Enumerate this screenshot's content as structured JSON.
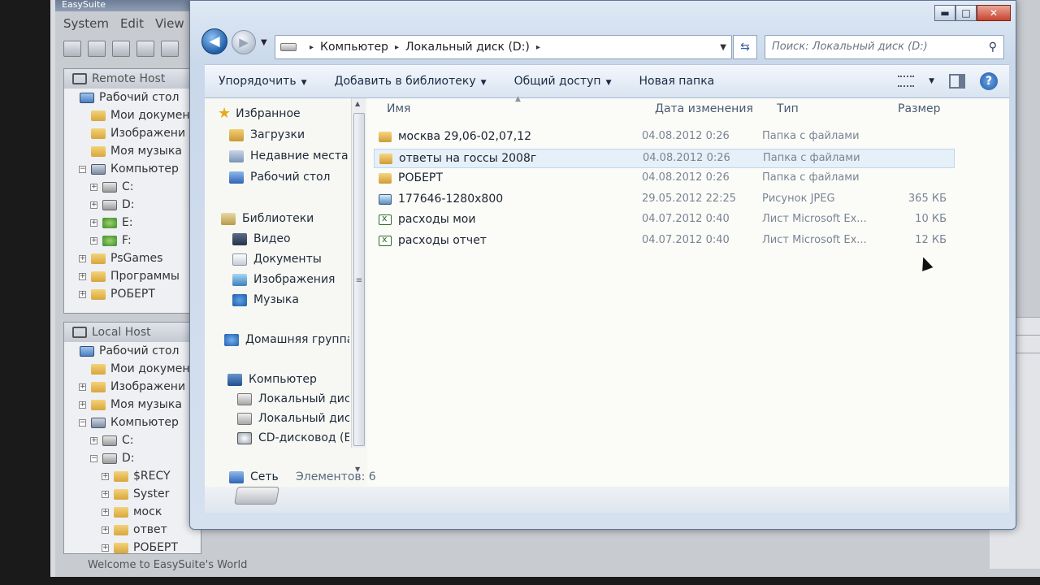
{
  "background_app": {
    "title": "EasySuite",
    "menu": [
      "System",
      "Edit",
      "View"
    ],
    "remote_panel": {
      "title": "Remote Host",
      "items": [
        {
          "label": "Рабочий стол",
          "icon": "desktop-icon",
          "indent": 0,
          "exp": ""
        },
        {
          "label": "Мои докумен",
          "icon": "folder-icon",
          "indent": 1,
          "exp": ""
        },
        {
          "label": "Изображени",
          "icon": "folder-icon",
          "indent": 1,
          "exp": ""
        },
        {
          "label": "Моя музыка",
          "icon": "folder-icon",
          "indent": 1,
          "exp": ""
        },
        {
          "label": "Компьютер",
          "icon": "computer-icon",
          "indent": 1,
          "exp": "−"
        },
        {
          "label": "C:",
          "icon": "drive-icon",
          "indent": 2,
          "exp": "+"
        },
        {
          "label": "D:",
          "icon": "drive-icon",
          "indent": 2,
          "exp": "+"
        },
        {
          "label": "E:",
          "icon": "network-drive-icon",
          "indent": 2,
          "exp": "+"
        },
        {
          "label": "F:",
          "icon": "network-drive-icon",
          "indent": 2,
          "exp": "+"
        },
        {
          "label": "PsGames",
          "icon": "folder-icon",
          "indent": 1,
          "exp": "+"
        },
        {
          "label": "Программы",
          "icon": "folder-icon",
          "indent": 1,
          "exp": "+"
        },
        {
          "label": "РОБЕРТ",
          "icon": "folder-icon",
          "indent": 1,
          "exp": "+"
        }
      ]
    },
    "local_panel": {
      "title": "Local Host",
      "items": [
        {
          "label": "Рабочий стол",
          "icon": "desktop-icon",
          "indent": 0,
          "exp": ""
        },
        {
          "label": "Мои докумен",
          "icon": "folder-icon",
          "indent": 1,
          "exp": ""
        },
        {
          "label": "Изображени",
          "icon": "folder-icon",
          "indent": 1,
          "exp": "+"
        },
        {
          "label": "Моя музыка",
          "icon": "folder-icon",
          "indent": 1,
          "exp": "+"
        },
        {
          "label": "Компьютер",
          "icon": "computer-icon",
          "indent": 1,
          "exp": "−"
        },
        {
          "label": "C:",
          "icon": "drive-icon",
          "indent": 2,
          "exp": "+"
        },
        {
          "label": "D:",
          "icon": "drive-icon",
          "indent": 2,
          "exp": "−"
        },
        {
          "label": "$RECY",
          "icon": "folder-icon",
          "indent": 3,
          "exp": "+"
        },
        {
          "label": "Syster",
          "icon": "folder-icon",
          "indent": 3,
          "exp": "+"
        },
        {
          "label": "моск",
          "icon": "folder-icon",
          "indent": 3,
          "exp": "+"
        },
        {
          "label": "ответ",
          "icon": "folder-icon",
          "indent": 3,
          "exp": "+"
        },
        {
          "label": "РОБЕРТ",
          "icon": "folder-icon",
          "indent": 3,
          "exp": "+"
        }
      ]
    },
    "status": "Welcome to EasySuite's World"
  },
  "explorer": {
    "window_controls": {
      "minimize": "▬",
      "maximize": "□",
      "close": "✕"
    },
    "nav": {
      "back": "◀",
      "forward": "▶",
      "recent": "▼"
    },
    "address": {
      "crumbs": [
        "Компьютер",
        "Локальный диск (D:)"
      ],
      "sep": "▸",
      "dropdown": "▼"
    },
    "refresh": "⇆",
    "search": {
      "placeholder": "Поиск: Локальный диск (D:)",
      "glyph": "⚲"
    },
    "commands": [
      {
        "label": "Упорядочить",
        "arrow": "▼"
      },
      {
        "label": "Добавить в библиотеку",
        "arrow": "▼"
      },
      {
        "label": "Общий доступ",
        "arrow": "▼"
      },
      {
        "label": "Новая папка",
        "arrow": ""
      }
    ],
    "view_arrow": "▼",
    "help": "?",
    "nav_pane": [
      {
        "label": "Избранное",
        "icon": "star-icon",
        "cls": "star"
      },
      {
        "label": "Загрузки",
        "icon": "downloads-icon",
        "cls": "nico-dl"
      },
      {
        "label": "Недавние места",
        "icon": "recent-places-icon",
        "cls": "nico-recent"
      },
      {
        "label": "Рабочий стол",
        "icon": "desktop-icon",
        "cls": "nico-desk"
      },
      {
        "label": "Библиотеки",
        "icon": "libraries-icon",
        "cls": "nico-lib"
      },
      {
        "label": "Видео",
        "icon": "video-icon",
        "cls": "nico-video"
      },
      {
        "label": "Документы",
        "icon": "documents-icon",
        "cls": "nico-doc"
      },
      {
        "label": "Изображения",
        "icon": "pictures-icon",
        "cls": "nico-img"
      },
      {
        "label": "Музыка",
        "icon": "music-icon",
        "cls": "nico-music"
      },
      {
        "label": "Домашняя группа",
        "icon": "homegroup-icon",
        "cls": "nico-home"
      },
      {
        "label": "Компьютер",
        "icon": "computer-icon",
        "cls": "nico-comp"
      },
      {
        "label": "Локальный диск",
        "icon": "local-disk-icon",
        "cls": "nico-disk"
      },
      {
        "label": "Локальный диск",
        "icon": "local-disk-icon",
        "cls": "nico-disk"
      },
      {
        "label": "CD-дисковод (E:",
        "icon": "cd-drive-icon",
        "cls": "nico-cd"
      },
      {
        "label": "Сеть",
        "icon": "network-icon",
        "cls": "nico-net"
      }
    ],
    "columns": {
      "name": "Имя",
      "date": "Дата изменения",
      "type": "Тип",
      "size": "Размер",
      "sort_caret": "▲"
    },
    "files": [
      {
        "name": "москва 29,06-02,07,12",
        "date": "04.08.2012 0:26",
        "type": "Папка с файлами",
        "size": "",
        "kind": "folder"
      },
      {
        "name": "ответы на госсы 2008г",
        "date": "04.08.2012 0:26",
        "type": "Папка с файлами",
        "size": "",
        "kind": "folder"
      },
      {
        "name": "РОБЕРТ",
        "date": "04.08.2012 0:26",
        "type": "Папка с файлами",
        "size": "",
        "kind": "folder"
      },
      {
        "name": "177646-1280x800",
        "date": "29.05.2012 22:25",
        "type": "Рисунок JPEG",
        "size": "365 КБ",
        "kind": "jpg"
      },
      {
        "name": "расходы мои",
        "date": "04.07.2012 0:40",
        "type": "Лист Microsoft Ex...",
        "size": "10 КБ",
        "kind": "xls"
      },
      {
        "name": "расходы отчет",
        "date": "04.07.2012 0:40",
        "type": "Лист Microsoft Ex...",
        "size": "12 КБ",
        "kind": "xls"
      }
    ],
    "hovered_row": 1,
    "item_count": "Элементов: 6",
    "scroll_glyphs": {
      "up": "▲",
      "down": "▼",
      "grip": "≡"
    }
  }
}
